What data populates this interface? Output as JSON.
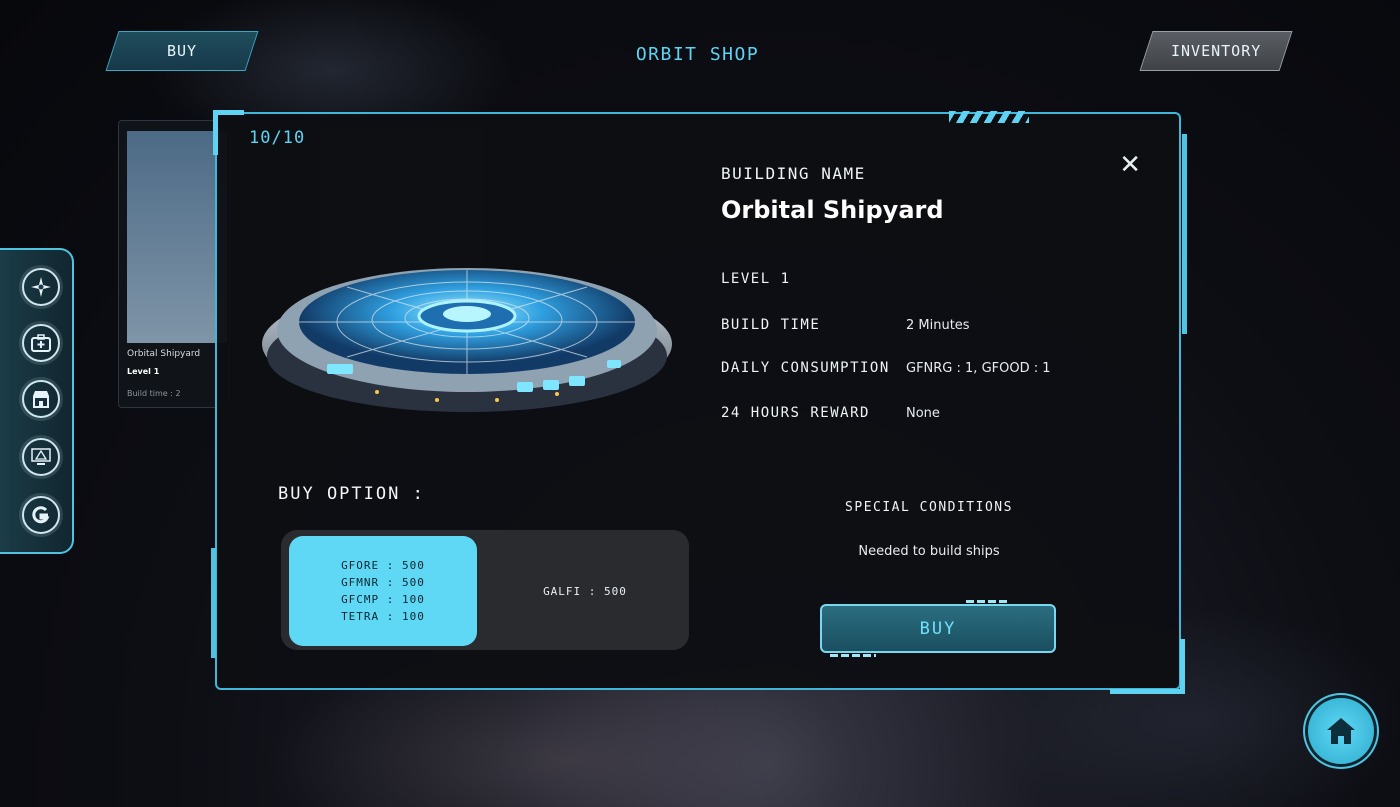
{
  "header": {
    "buy_tab_label": "BUY",
    "title": "ORBIT SHOP",
    "inventory_label": "INVENTORY"
  },
  "side_dock": {
    "items": [
      {
        "icon": "compass-star-icon"
      },
      {
        "icon": "medkit-icon"
      },
      {
        "icon": "shop-icon"
      },
      {
        "icon": "warning-screen-icon"
      },
      {
        "icon": "g-logo-icon"
      }
    ]
  },
  "background_card": {
    "name": "Orbital Shipyard",
    "level": "Level 1",
    "build_time": "Build time : 2"
  },
  "panel": {
    "counter": "10/10",
    "close_icon": "close-icon",
    "building_name_label": "BUILDING NAME",
    "building_name": "Orbital Shipyard",
    "level": "LEVEL 1",
    "build_time_label": "BUILD TIME",
    "build_time_value": "2 Minutes",
    "daily_consumption_label": "DAILY CONSUMPTION",
    "daily_consumption_value": "GFNRG : 1, GFOOD : 1",
    "reward_label": "24 HOURS REWARD",
    "reward_value": "None",
    "buy_option_label": "BUY OPTION :",
    "options": {
      "a_lines": [
        "GFORE : 500",
        "GFMNR : 500",
        "GFCMP : 100",
        "TETRA : 100"
      ],
      "b_line": "GALFI : 500"
    },
    "special_conditions_label": "SPECIAL CONDITIONS",
    "special_conditions_value": "Needed to build ships",
    "buy_button_label": "BUY"
  },
  "home_button": {
    "icon": "home-icon"
  },
  "colors": {
    "accent": "#5fd4f2",
    "panel_bg": "#0e0f13",
    "option_selected": "#5fd8f6",
    "option_box": "#2a2b2f",
    "buy_button": "#1a4f60"
  }
}
